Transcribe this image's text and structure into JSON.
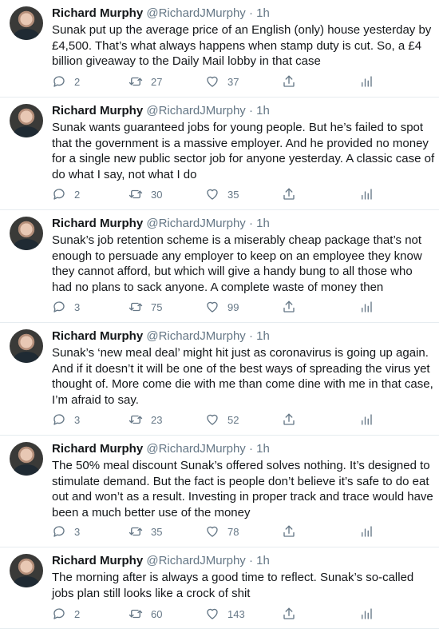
{
  "tweets": [
    {
      "name": "Richard Murphy",
      "handle": "@RichardJMurphy",
      "sep": "·",
      "time": "1h",
      "text": "Sunak put up the average price of an English (only) house yesterday by £4,500. That’s what always happens when stamp duty is cut. So, a £4 billion giveaway to the Daily Mail lobby in that case",
      "replies": "2",
      "retweets": "27",
      "likes": "37"
    },
    {
      "name": "Richard Murphy",
      "handle": "@RichardJMurphy",
      "sep": "·",
      "time": "1h",
      "text": "Sunak wants guaranteed jobs for young people. But he’s failed to spot that the government is a massive employer. And he provided no money for a single new public sector job for anyone yesterday. A classic case of do what I say, not what I do",
      "replies": "2",
      "retweets": "30",
      "likes": "35"
    },
    {
      "name": "Richard Murphy",
      "handle": "@RichardJMurphy",
      "sep": "·",
      "time": "1h",
      "text": "Sunak’s job retention scheme is a miserably cheap package that’s not enough to persuade any employer to keep on an employee they know they cannot afford, but which will give a handy bung to all those who had no plans to sack anyone.  A complete waste of money then",
      "replies": "3",
      "retweets": "75",
      "likes": "99"
    },
    {
      "name": "Richard Murphy",
      "handle": "@RichardJMurphy",
      "sep": "·",
      "time": "1h",
      "text": "Sunak’s ‘new meal deal’ might hit just as coronavirus is going up again. And if it doesn’t it will be one of the best ways of spreading the virus yet thought of. More come die with me than come dine with me in that case, I’m afraid to say.",
      "replies": "3",
      "retweets": "23",
      "likes": "52"
    },
    {
      "name": "Richard Murphy",
      "handle": "@RichardJMurphy",
      "sep": "·",
      "time": "1h",
      "text": "The 50% meal discount Sunak’s offered solves nothing. It’s designed to stimulate demand. But the fact is people don’t believe it’s safe to do eat out and won’t as a result. Investing in proper track and trace would have been a much better use of the money",
      "replies": "3",
      "retweets": "35",
      "likes": "78"
    },
    {
      "name": "Richard Murphy",
      "handle": "@RichardJMurphy",
      "sep": "·",
      "time": "1h",
      "text": "The morning after is always a good time to reflect. Sunak’s so-called jobs plan still looks like a crock of shit",
      "replies": "2",
      "retweets": "60",
      "likes": "143"
    }
  ]
}
